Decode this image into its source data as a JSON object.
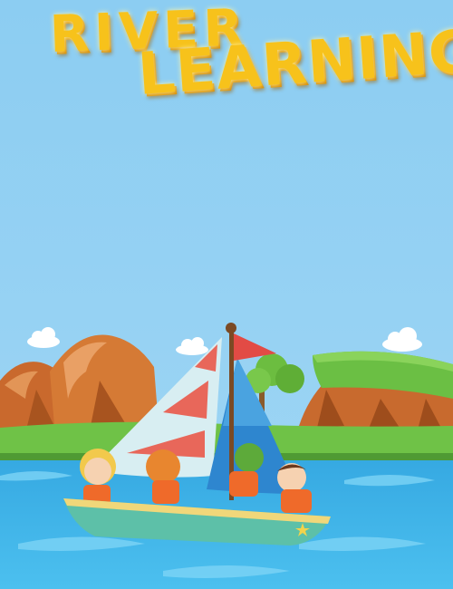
{
  "title": {
    "line1": "RIVER",
    "line2": "LEARNING"
  },
  "colors": {
    "sky": "#8cccf1",
    "title": "#f7c21b",
    "water": "#3fb2e8",
    "grass": "#6fc247",
    "cliff": "#c86a2e",
    "boat_hull": "#5dc0a8",
    "sail_blue": "#2e86cf",
    "sail_stripe": "#e8675a",
    "flag": "#e24b45",
    "life_vest": "#ef6a2a"
  },
  "icons": [
    "cloud-icon",
    "star-icon"
  ]
}
